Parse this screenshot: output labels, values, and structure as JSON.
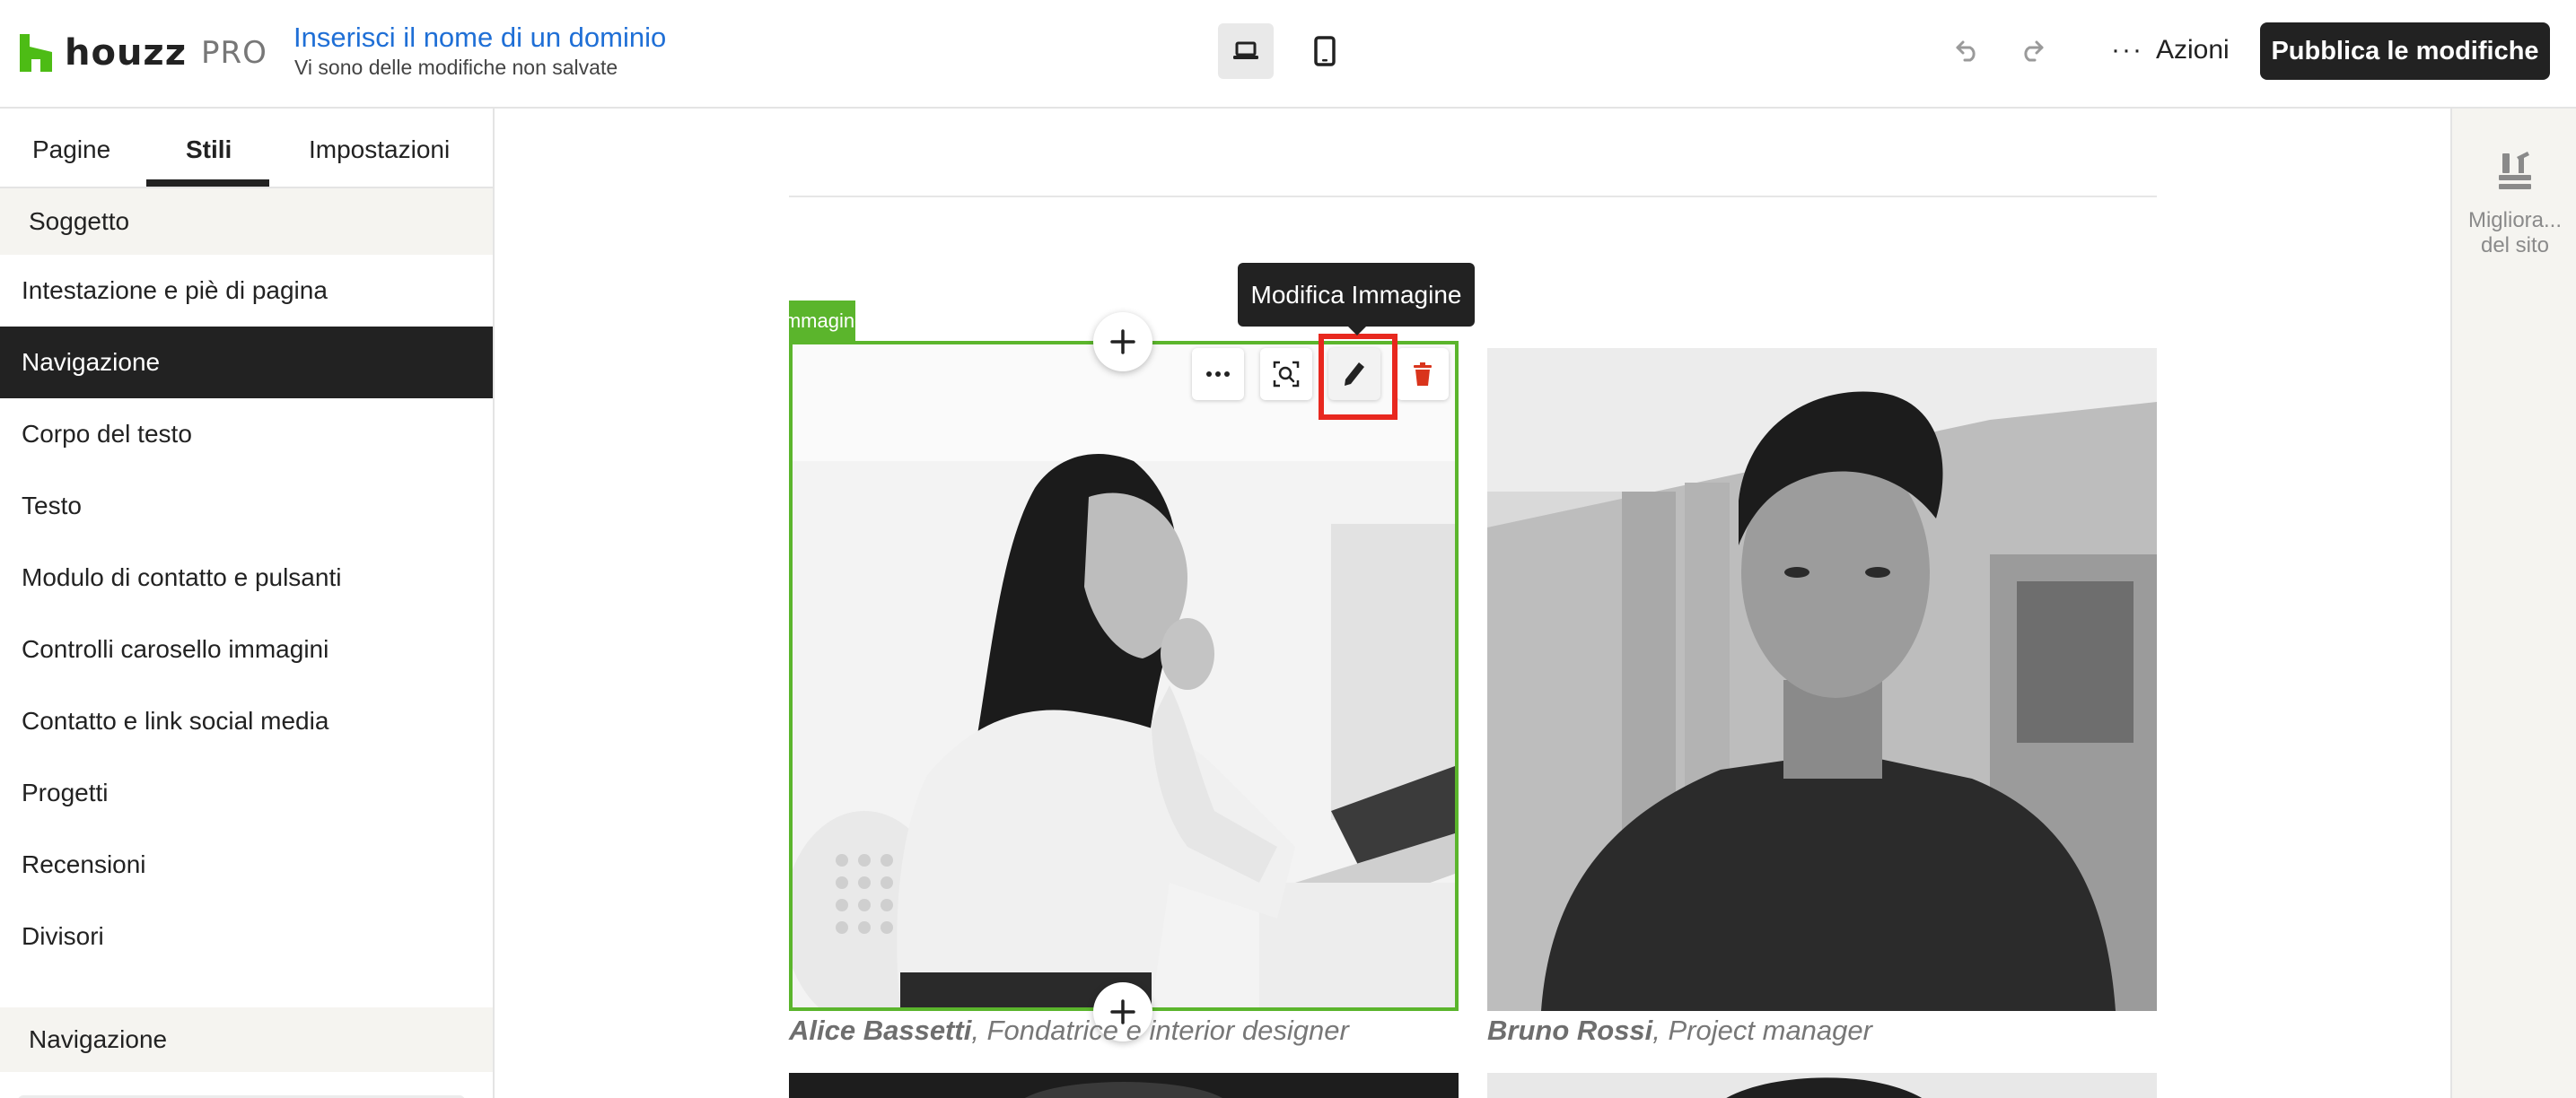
{
  "header": {
    "logo_text": "houzz",
    "logo_pro": "PRO",
    "site_title": "Inserisci il nome di un dominio",
    "site_status": "Vi sono delle modifiche non salvate",
    "device_desktop_icon": "laptop-icon",
    "device_tablet_icon": "tablet-icon",
    "undo_icon": "undo-icon",
    "redo_icon": "redo-icon",
    "actions_dots": "···",
    "actions_label": "Azioni",
    "publish_label": "Pubblica le modifiche"
  },
  "sidebar": {
    "tabs": [
      {
        "label": "Pagine"
      },
      {
        "label": "Stili"
      },
      {
        "label": "Impostazioni"
      }
    ],
    "active_tab": "Stili",
    "section_title": "Soggetto",
    "items": [
      {
        "label": "Intestazione e piè di pagina"
      },
      {
        "label": "Navigazione"
      },
      {
        "label": "Corpo del testo"
      },
      {
        "label": "Testo"
      },
      {
        "label": "Modulo di contatto e pulsanti"
      },
      {
        "label": "Controlli carosello immagini"
      },
      {
        "label": "Contatto e link social media"
      },
      {
        "label": "Progetti"
      },
      {
        "label": "Recensioni"
      },
      {
        "label": "Divisori"
      }
    ],
    "active_item": "Navigazione",
    "section2_title": "Navigazione"
  },
  "canvas": {
    "image_block_label": "Immagine",
    "tooltip": "Modifica Immagine",
    "toolbar_icons": [
      "more-icon",
      "zoom-icon",
      "pencil-icon",
      "trash-icon"
    ],
    "team": [
      {
        "name": "Alice Bassetti",
        "role": ", Fondatrice e interior designer"
      },
      {
        "name": "Bruno Rossi",
        "role": ", Project manager"
      }
    ]
  },
  "right_rail": {
    "label_line1": "Migliora...",
    "label_line2": "del sito"
  },
  "colors": {
    "accent_blue": "#1f6fd6",
    "logo_green": "#4dbc15",
    "selection_green": "#5bb52c",
    "highlight_red": "#e8281f",
    "dark": "#222222"
  }
}
